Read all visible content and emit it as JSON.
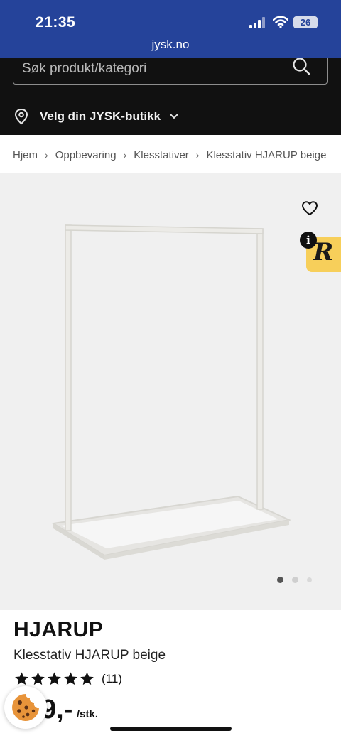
{
  "status_bar": {
    "time": "21:35",
    "battery": "26",
    "url": "jysk.no"
  },
  "header": {
    "search_placeholder": "Søk produkt/kategori",
    "store_label": "Velg din JYSK-butikk"
  },
  "breadcrumb": [
    "Hjem",
    "Oppbevaring",
    "Klesstativer",
    "Klesstativ HJARUP beige"
  ],
  "gallery": {
    "slide_count": 3,
    "active_slide": 1
  },
  "badge": {
    "letter": "R",
    "info": "i"
  },
  "product": {
    "name": "HJARUP",
    "subtitle": "Klesstativ HJARUP beige",
    "rating_stars": 5,
    "review_count": "(11)",
    "price": "9,-",
    "unit": "/stk."
  },
  "colors": {
    "brand_blue": "#25439a",
    "header_bg": "#111111",
    "badge_yellow": "#f7cf5a"
  }
}
